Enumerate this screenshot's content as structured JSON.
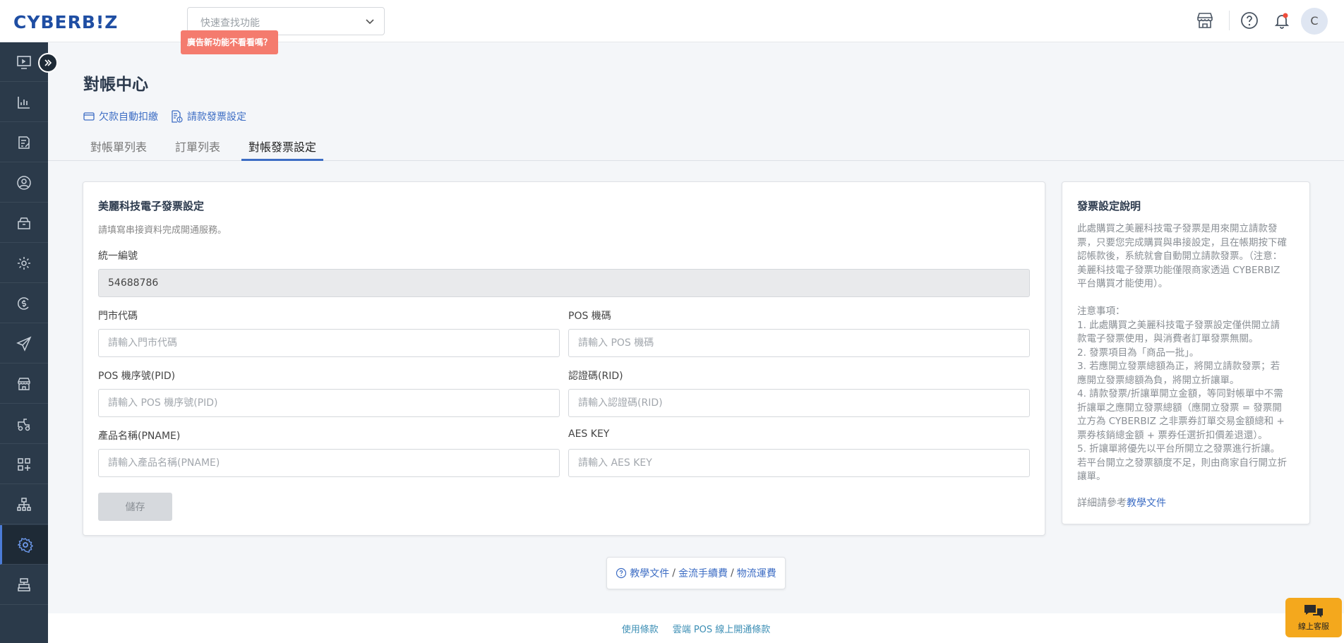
{
  "brand": {
    "logo_text": "CYBERB!Z",
    "accent": "#3d6dc4",
    "sidebar_bg": "#2b3a4a",
    "promo_bg": "#f47b6e"
  },
  "header": {
    "search_placeholder": "快速查找功能",
    "promo_label": "廣告新功能不看看嗎？",
    "icons": [
      "store-icon",
      "help-circle-icon",
      "bell-icon"
    ],
    "avatar_initial": "C"
  },
  "sidebar": {
    "items": [
      {
        "icon": "monitor-icon"
      },
      {
        "icon": "chart-icon"
      },
      {
        "icon": "edit-list-icon"
      },
      {
        "icon": "user-icon"
      },
      {
        "icon": "shop-bag-icon"
      },
      {
        "icon": "gear-icon"
      },
      {
        "icon": "coin-icon"
      },
      {
        "icon": "send-icon"
      },
      {
        "icon": "storefront-icon"
      },
      {
        "icon": "delivery-icon"
      },
      {
        "icon": "apps-add-icon"
      },
      {
        "icon": "network-icon"
      },
      {
        "icon": "settings-icon",
        "active": true
      },
      {
        "icon": "register-icon"
      }
    ]
  },
  "page": {
    "title": "對帳中心",
    "links": [
      {
        "label": "欠款自動扣繳",
        "icon": "card-icon"
      },
      {
        "label": "請款發票設定",
        "icon": "invoice-icon"
      }
    ],
    "tabs": [
      {
        "label": "對帳單列表",
        "active": false
      },
      {
        "label": "訂單列表",
        "active": false
      },
      {
        "label": "對帳發票設定",
        "active": true
      }
    ]
  },
  "form": {
    "title": "美麗科技電子發票設定",
    "subtitle": "請填寫串接資料完成開通服務。",
    "tax_id": {
      "label": "統一編號",
      "value": "54688786"
    },
    "store_code": {
      "label": "門市代碼",
      "placeholder": "請輸入門市代碼"
    },
    "pos_code": {
      "label": "POS 機碼",
      "placeholder": "請輸入 POS 機碼"
    },
    "pos_pid": {
      "label": "POS 機序號(PID)",
      "placeholder": "請輸入 POS 機序號(PID)"
    },
    "rid": {
      "label": "認證碼(RID)",
      "placeholder": "請輸入認證碼(RID)"
    },
    "pname": {
      "label": "產品名稱(PNAME)",
      "placeholder": "請輸入產品名稱(PNAME)"
    },
    "aes_key": {
      "label": "AES KEY",
      "placeholder": "請輸入 AES KEY"
    },
    "save_label": "儲存"
  },
  "info": {
    "title": "發票設定說明",
    "intro_lines": [
      "此處購買之美麗科技電子發票是用來開立請款發",
      "票，只要您完成購買與串接設定，且在帳期按下確",
      "認帳款後，系統就會自動開立請款發票。（注意：",
      "美麗科技電子發票功能僅限商家透過 CYBERBIZ",
      "平台購買才能使用）。"
    ],
    "notes_lines": [
      "注意事項：",
      "1. 此處購買之美麗科技電子發票設定僅供開立請",
      "款電子發票使用，與消費者訂單發票無關。",
      "2. 發票項目為「商品一批」。",
      "3. 若應開立發票總額為正，將開立請款發票；若",
      "應開立發票總額為負，將開立折讓單。",
      "4. 請款發票/折讓單開立金額，等同對帳單中不需",
      "折讓單之應開立發票總額（應開立發票 = 發票開",
      "立方為 CYBERBIZ 之非票券訂單交易金額總和 +",
      "票券核銷總金額 + 票券任選折扣價差退還）。",
      "5. 折讓單將優先以平台所開立之發票進行折讓。",
      "若平台開立之發票額度不足，則由商家自行開立折",
      "讓單。"
    ],
    "ref_prefix": "詳細請參考",
    "ref_link": "教學文件"
  },
  "help": {
    "links": [
      "教學文件",
      "金流手續費",
      "物流運費"
    ],
    "sep": "/"
  },
  "footer": {
    "links": [
      "使用條款",
      "雲端 POS 線上開通條款"
    ]
  },
  "chat": {
    "label": "線上客服"
  }
}
